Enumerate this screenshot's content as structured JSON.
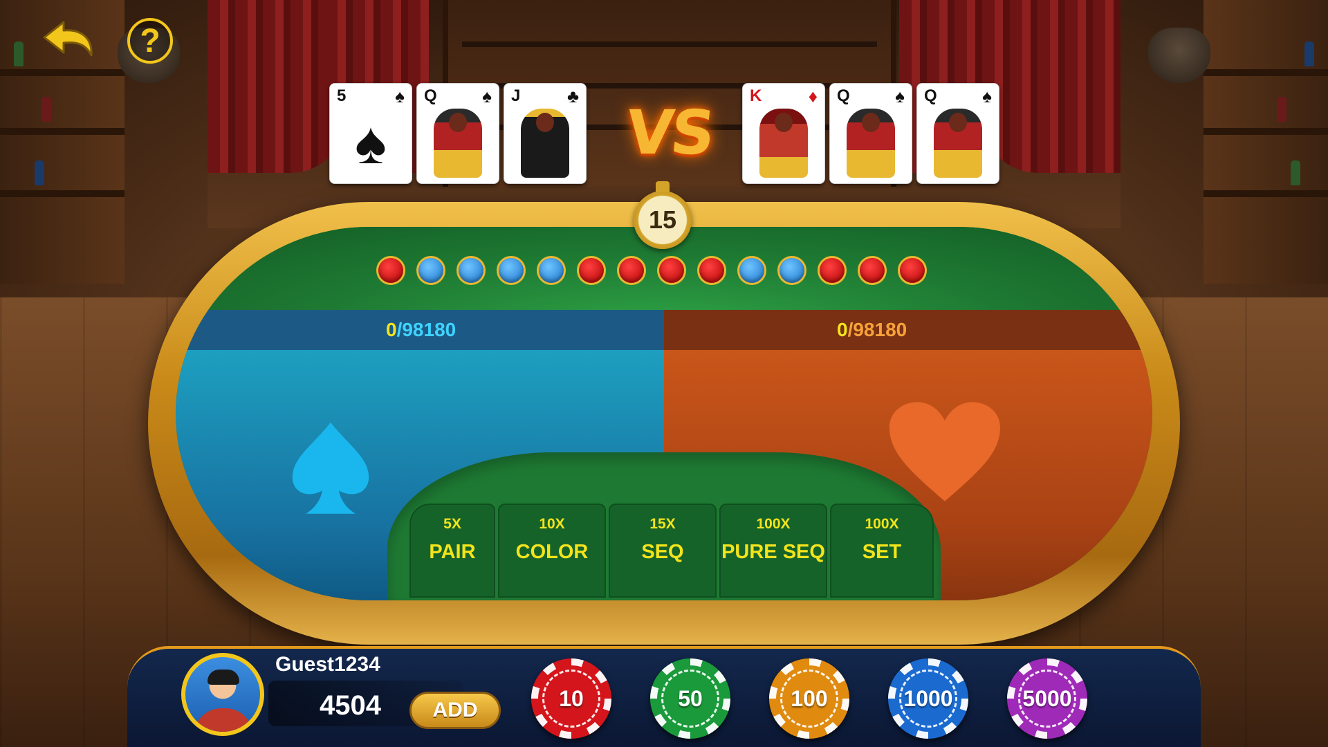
{
  "header": {
    "back_label": "back",
    "help_label": "?"
  },
  "cards": {
    "left": [
      {
        "rank": "5",
        "suit": "♠",
        "color": "black",
        "type": "pip"
      },
      {
        "rank": "Q",
        "suit": "♠",
        "color": "black",
        "type": "queen"
      },
      {
        "rank": "J",
        "suit": "♣",
        "color": "black",
        "type": "jack"
      }
    ],
    "right": [
      {
        "rank": "K",
        "suit": "♦",
        "color": "red",
        "type": "king"
      },
      {
        "rank": "Q",
        "suit": "♠",
        "color": "black",
        "type": "queen"
      },
      {
        "rank": "Q",
        "suit": "♠",
        "color": "black",
        "type": "queen"
      }
    ],
    "vs_label": "VS"
  },
  "timer": {
    "value": "15"
  },
  "history": [
    "red",
    "blue",
    "blue",
    "blue",
    "blue",
    "red",
    "red",
    "red",
    "red",
    "blue",
    "blue",
    "red",
    "red",
    "red"
  ],
  "bets": {
    "left": {
      "current": "0",
      "max": "/98180"
    },
    "right": {
      "current": "0",
      "max": "/98180"
    }
  },
  "side_bets": [
    {
      "mult": "5X",
      "name": "PAIR"
    },
    {
      "mult": "10X",
      "name": "COLOR"
    },
    {
      "mult": "15X",
      "name": "SEQ"
    },
    {
      "mult": "100X",
      "name": "PURE SEQ"
    },
    {
      "mult": "100X",
      "name": "SET"
    }
  ],
  "player": {
    "username": "Guest1234",
    "balance": "4504",
    "add_label": "ADD"
  },
  "chips": [
    {
      "value": "10",
      "color": "#d4151b"
    },
    {
      "value": "50",
      "color": "#1a9a3a"
    },
    {
      "value": "100",
      "color": "#e08a10"
    },
    {
      "value": "1000",
      "color": "#1a6ad0"
    },
    {
      "value": "5000",
      "color": "#a02ab8"
    }
  ],
  "colors": {
    "spade_zone": "#1d9fc0",
    "heart_zone": "#c9561a",
    "felt": "#1f7a32",
    "gold": "#f3c61b"
  }
}
